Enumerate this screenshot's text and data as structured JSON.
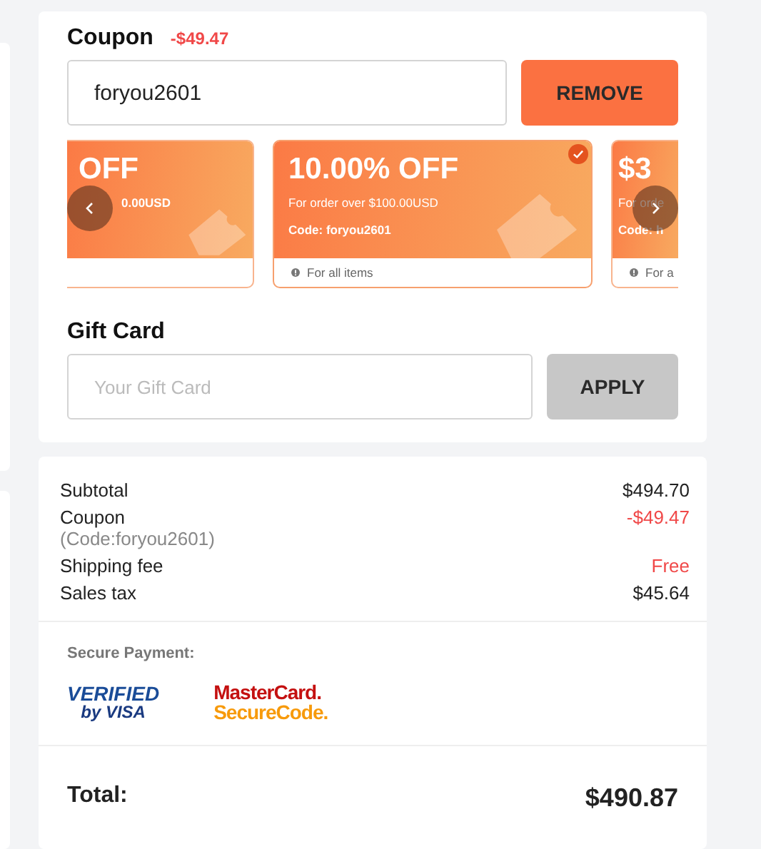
{
  "coupon": {
    "title": "Coupon",
    "discount": "-$49.47",
    "value": "foryou2601",
    "button": "REMOVE",
    "cards": [
      {
        "kind": "left-cut",
        "title": "OFF",
        "condition": "0.00USD",
        "selected": false
      },
      {
        "kind": "full",
        "title": "10.00% OFF",
        "condition": "For order over $100.00USD",
        "code": "Code: foryou2601",
        "footer": "For all items",
        "selected": true
      },
      {
        "kind": "right-cut",
        "title": "$3",
        "condition": "For orde",
        "code": "Code: h",
        "footer": "For a",
        "selected": false
      }
    ]
  },
  "gift_card": {
    "title": "Gift Card",
    "placeholder": "Your Gift Card",
    "button": "APPLY"
  },
  "summary": [
    {
      "label": "Subtotal",
      "value": "$494.70",
      "highlight": false
    },
    {
      "label": "Coupon",
      "note": "(Code:foryou2601)",
      "value": "-$49.47",
      "highlight": true
    },
    {
      "label": "Shipping fee",
      "value": "Free",
      "highlight": true
    },
    {
      "label": "Sales tax",
      "value": "$45.64",
      "highlight": false
    }
  ],
  "secure_payment": {
    "title": "Secure Payment:",
    "visa": [
      "VERIFIED",
      "by VISA"
    ],
    "mastercard": [
      "MasterCard.",
      "SecureCode."
    ]
  },
  "total": {
    "label": "Total:",
    "value": "$490.87"
  }
}
